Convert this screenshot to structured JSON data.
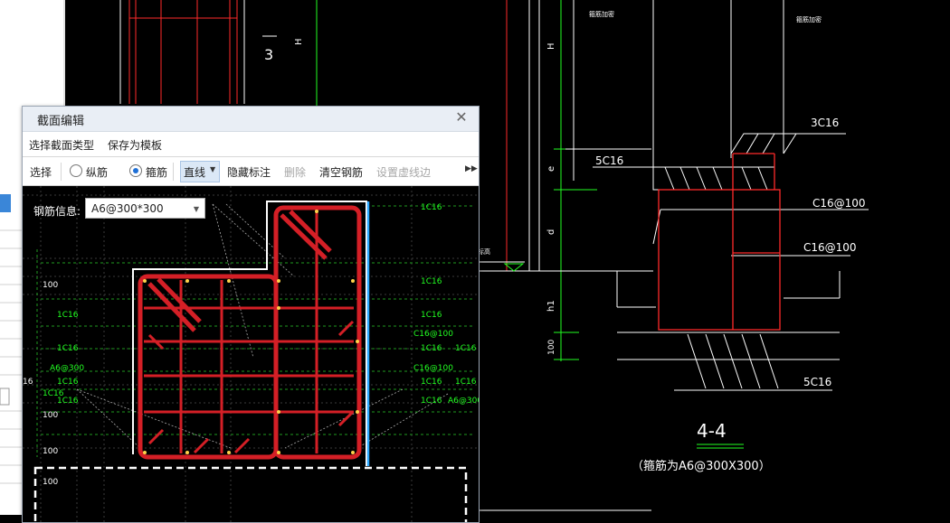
{
  "dialog": {
    "title": "截面编辑",
    "close_glyph": "✕",
    "menu": {
      "select_section_type": "选择截面类型",
      "save_as_template": "保存为模板"
    },
    "toolbar": {
      "select": "选择",
      "longitudinal": "纵筋",
      "stirrup": "箍筋",
      "line_mode": "直线",
      "hide_annotation": "隐藏标注",
      "delete": "删除",
      "clear_rebar": "清空钢筋",
      "set_dashed_edge": "设置虚线边",
      "selected_radio": "stirrup"
    },
    "rebar_info_label": "钢筋信息:",
    "rebar_info_value": "A6@300*300"
  },
  "canvas_labels": {
    "c16": "1C16",
    "c16_at100": "C16@100",
    "a6_at300": "A6@300",
    "dim100": "100",
    "dim16": "16"
  },
  "drawing": {
    "label_3": "3",
    "label_H": "H",
    "label_e": "e",
    "label_d": "d",
    "label_h1": "h1",
    "label_100": "100",
    "rebar_3c16": "3C16",
    "rebar_5c16_top": "5C16",
    "rebar_c16_at100_a": "C16@100",
    "rebar_c16_at100_b": "C16@100",
    "rebar_5c16_bottom": "5C16",
    "section_title": "4-4",
    "stirrup_note": "（箍筋为A6@300X300）",
    "small_note_1": "箍筋加密",
    "small_note_2": "箍筋加密",
    "small_note_3": "标高"
  },
  "colors": {
    "background": "#000000",
    "cad_red": "#ff2a2a",
    "cad_green": "#22ff22",
    "cad_white": "#ffffff",
    "rebar_red": "#d41f26",
    "highlight_blue": "#2aa7ff"
  }
}
